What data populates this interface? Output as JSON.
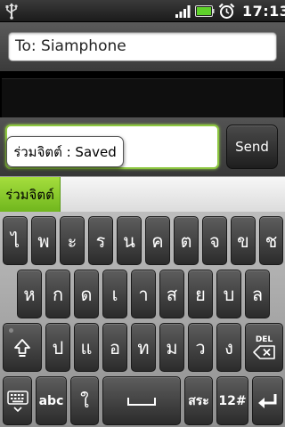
{
  "status_bar": {
    "time": "17:13",
    "icons": [
      "usb-icon",
      "signal-icon",
      "battery-icon",
      "alarm-icon"
    ]
  },
  "recipient": {
    "value": "To: Siamphone"
  },
  "compose": {
    "message_value": "",
    "send_label": "Send",
    "toast": "ร่วมจิตต์ : Saved"
  },
  "suggestions": {
    "items": [
      "ร่วมจิตต์"
    ]
  },
  "keyboard": {
    "row1": [
      "ไ",
      "พ",
      "ะ",
      "ร",
      "น",
      "ค",
      "ต",
      "จ",
      "ข",
      "ช"
    ],
    "row2": [
      "ห",
      "ก",
      "ด",
      "เ",
      "า",
      "ส",
      "ย",
      "บ",
      "ล"
    ],
    "row3": [
      "ป",
      "แ",
      "อ",
      "ท",
      "ม",
      "ว",
      "ง"
    ],
    "row4": {
      "abc_label": "abc",
      "vowel": "ใ",
      "vowel2": "สระ",
      "numbers_label": "12#",
      "del_label": "DEL"
    }
  },
  "colors": {
    "accent_green": "#8cc63f",
    "key_bg": "#333333",
    "keyboard_bg": "#a8a8a8"
  }
}
